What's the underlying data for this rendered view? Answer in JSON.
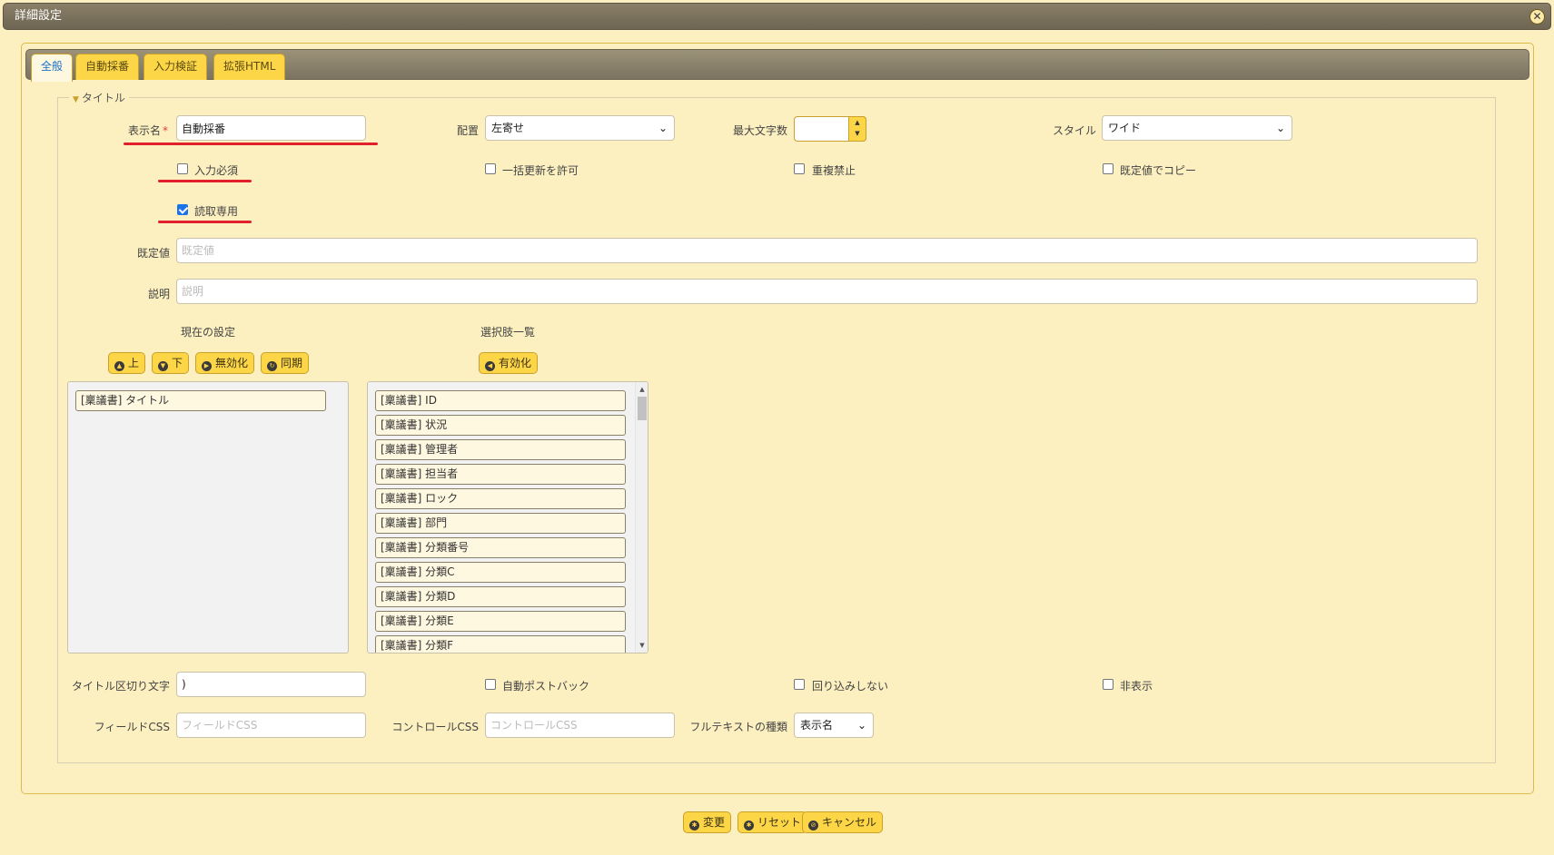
{
  "window": {
    "title": "詳細設定"
  },
  "tabs": [
    {
      "label": "全般",
      "active": true
    },
    {
      "label": "自動採番",
      "active": false
    },
    {
      "label": "入力検証",
      "active": false
    },
    {
      "label": "拡張HTML",
      "active": false
    }
  ],
  "fieldset": {
    "legend": "タイトル"
  },
  "fields": {
    "display_name": {
      "label": "表示名",
      "required_mark": "*",
      "value": "自動採番"
    },
    "alignment": {
      "label": "配置",
      "value": "左寄せ"
    },
    "max_length": {
      "label": "最大文字数",
      "value": ""
    },
    "style": {
      "label": "スタイル",
      "value": "ワイド"
    },
    "default_value": {
      "label": "既定値",
      "value": "",
      "placeholder": "既定値"
    },
    "description": {
      "label": "説明",
      "value": "",
      "placeholder": "説明"
    },
    "title_separator": {
      "label": "タイトル区切り文字",
      "value": ")"
    },
    "field_css": {
      "label": "フィールドCSS",
      "value": "",
      "placeholder": "フィールドCSS"
    },
    "control_css": {
      "label": "コントロールCSS",
      "value": "",
      "placeholder": "コントロールCSS"
    },
    "fulltext_type": {
      "label": "フルテキストの種類",
      "value": "表示名"
    }
  },
  "checkboxes": {
    "required": {
      "label": "入力必須",
      "checked": false
    },
    "bulk_update": {
      "label": "一括更新を許可",
      "checked": false
    },
    "no_duplicates": {
      "label": "重複禁止",
      "checked": false
    },
    "copy_by_default": {
      "label": "既定値でコピー",
      "checked": false
    },
    "read_only": {
      "label": "読取専用",
      "checked": true
    },
    "auto_postback": {
      "label": "自動ポストバック",
      "checked": false
    },
    "no_wrap": {
      "label": "回り込みしない",
      "checked": false
    },
    "hidden": {
      "label": "非表示",
      "checked": false
    }
  },
  "current_settings": {
    "heading": "現在の設定",
    "buttons": {
      "up": "上",
      "down": "下",
      "disable": "無効化",
      "sync": "同期"
    },
    "items": [
      "[稟議書] タイトル"
    ]
  },
  "options_list": {
    "heading": "選択肢一覧",
    "buttons": {
      "enable": "有効化"
    },
    "items": [
      "[稟議書] ID",
      "[稟議書] 状況",
      "[稟議書] 管理者",
      "[稟議書] 担当者",
      "[稟議書] ロック",
      "[稟議書] 部門",
      "[稟議書] 分類番号",
      "[稟議書] 分類C",
      "[稟議書] 分類D",
      "[稟議書] 分類E",
      "[稟議書] 分類F"
    ]
  },
  "footer": {
    "change": "変更",
    "reset": "リセット",
    "cancel": "キャンセル"
  },
  "colors": {
    "accent": "#fdd648",
    "background": "#fdf0c0",
    "highlight": "#e0202a",
    "link": "#1a6fc4"
  },
  "icons": {
    "close": "close-icon",
    "up": "arrow-up-icon",
    "down": "arrow-down-icon",
    "disable": "arrow-right-icon",
    "sync": "sync-icon",
    "enable": "arrow-left-icon",
    "change": "gear-icon",
    "reset": "gear-icon",
    "cancel": "cancel-icon"
  }
}
